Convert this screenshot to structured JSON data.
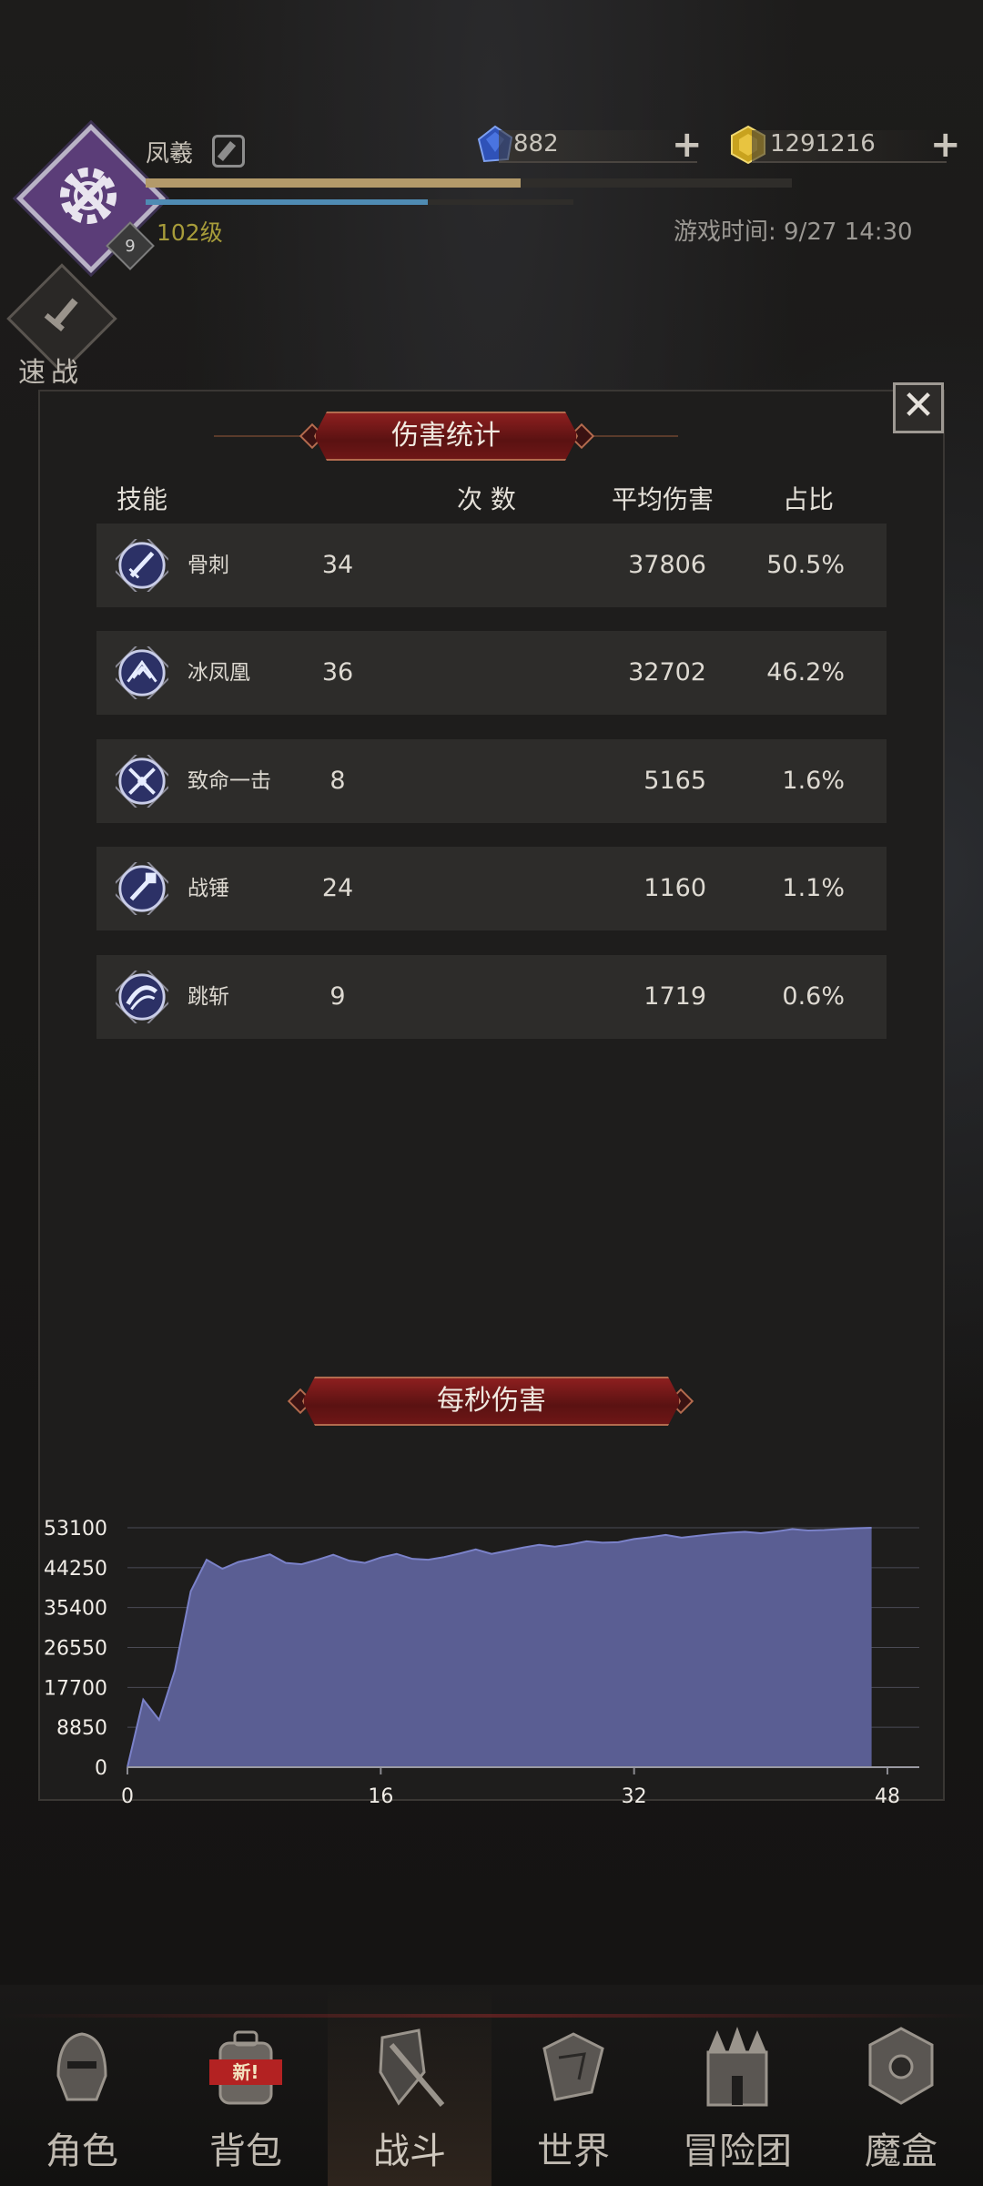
{
  "player": {
    "name": "凤羲",
    "level": "102级",
    "badge": "9",
    "xp_fraction": 0.58,
    "mp_fraction": 0.66
  },
  "resources": [
    {
      "name": "gem-icon",
      "value": "882",
      "color": "#2f52b8"
    },
    {
      "name": "gold-ore-icon",
      "value": "1291216",
      "color": "#c8a21e"
    }
  ],
  "game_time": "游戏时间: 9/27 14:30",
  "quick_battle_label": "速战",
  "damage_stats": {
    "title": "伤害统计",
    "columns": [
      "技能",
      "次 数",
      "平均伤害",
      "占比"
    ],
    "rows": [
      {
        "icon": "sword-skill-icon",
        "skill": "骨刺",
        "count": "34",
        "avg": "37806",
        "pct": "50.5%"
      },
      {
        "icon": "ice-phoenix-skill-icon",
        "skill": "冰凤凰",
        "count": "36",
        "avg": "32702",
        "pct": "46.2%"
      },
      {
        "icon": "critical-strike-skill-icon",
        "skill": "致命一击",
        "count": "8",
        "avg": "5165",
        "pct": "1.6%"
      },
      {
        "icon": "war-hammer-skill-icon",
        "skill": "战锤",
        "count": "24",
        "avg": "1160",
        "pct": "1.1%"
      },
      {
        "icon": "leap-slash-skill-icon",
        "skill": "跳斩",
        "count": "9",
        "avg": "1719",
        "pct": "0.6%"
      }
    ]
  },
  "dps_title": "每秒伤害",
  "chart_data": {
    "type": "area",
    "title": "每秒伤害",
    "color": "#5a5e93",
    "line_color": "#7b82c9",
    "ylim": [
      0,
      53100
    ],
    "xlim": [
      0,
      48
    ],
    "y_ticks": [
      "0",
      "8850",
      "17700",
      "26550",
      "35400",
      "44250",
      "53100"
    ],
    "x_ticks": [
      "0",
      "16",
      "32",
      "48"
    ],
    "x": [
      0,
      1,
      2,
      3,
      4,
      5,
      6,
      7,
      8,
      9,
      10,
      11,
      12,
      13,
      14,
      15,
      16,
      17,
      18,
      19,
      20,
      21,
      22,
      23,
      24,
      25,
      26,
      27,
      28,
      29,
      30,
      31,
      32,
      33,
      34,
      35,
      36,
      37,
      38,
      39,
      40,
      41,
      42,
      43,
      44,
      45,
      46,
      47
    ],
    "y": [
      0,
      15000,
      10500,
      21500,
      39000,
      46000,
      44000,
      45500,
      46300,
      47200,
      45300,
      45000,
      46000,
      47100,
      45800,
      45300,
      46500,
      47300,
      46200,
      46000,
      46600,
      47400,
      48300,
      47300,
      48000,
      48700,
      49300,
      48900,
      49400,
      50100,
      49800,
      49900,
      50600,
      51000,
      51500,
      50900,
      51300,
      51700,
      52000,
      52200,
      51900,
      52300,
      52800,
      52500,
      52600,
      52800,
      53000,
      53100
    ]
  },
  "nav": [
    {
      "icon": "helmet-icon",
      "label": "角色",
      "active": false
    },
    {
      "icon": "backpack-icon",
      "label": "背包",
      "active": false,
      "tag": "新!"
    },
    {
      "icon": "shield-sword-icon",
      "label": "战斗",
      "active": true
    },
    {
      "icon": "world-map-icon",
      "label": "世界",
      "active": false
    },
    {
      "icon": "castle-icon",
      "label": "冒险团",
      "active": false
    },
    {
      "icon": "magic-box-icon",
      "label": "魔盒",
      "active": false
    }
  ]
}
